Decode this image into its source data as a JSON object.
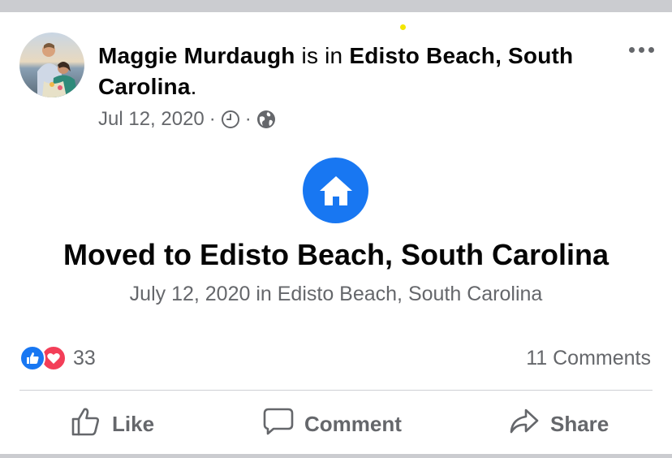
{
  "post": {
    "author": "Maggie Murdaugh",
    "connector": "is in",
    "location_line1": "Edisto Beach, South",
    "location_line2": "Carolina",
    "period": ".",
    "date": "Jul 12, 2020",
    "separator": "·",
    "icons": [
      "clock-icon",
      "globe-icon"
    ]
  },
  "life_event": {
    "icon": "home-icon",
    "title": "Moved to Edisto Beach, South Carolina",
    "subtitle": "July 12, 2020 in Edisto Beach, South Carolina"
  },
  "reactions": {
    "types": [
      "like",
      "love"
    ],
    "count": "33",
    "comments": "11 Comments"
  },
  "actions": {
    "like": "Like",
    "comment": "Comment",
    "share": "Share"
  },
  "colors": {
    "accent": "#1877f2",
    "love": "#f33e58",
    "secondary_text": "#65676b",
    "primary_text": "#050505"
  }
}
